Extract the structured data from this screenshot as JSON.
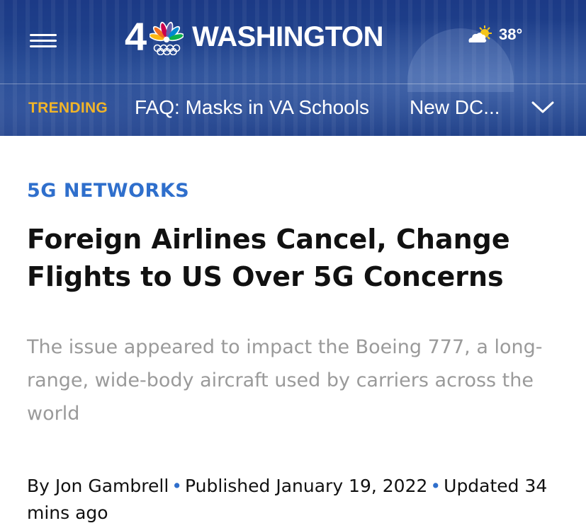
{
  "header": {
    "logo_number": "4",
    "logo_word": "WASHINGTON",
    "weather": {
      "icon": "partly-sunny-icon",
      "temp": "38°"
    }
  },
  "trending": {
    "label": "TRENDING",
    "items": [
      "FAQ: Masks in VA Schools",
      "New DC..."
    ]
  },
  "article": {
    "category": "5G NETWORKS",
    "headline": "Foreign Airlines Cancel, Change Flights to US Over 5G Concerns",
    "dek": "The issue appeared to impact the Boeing 777, a long-range, wide-body aircraft used by carriers across the world",
    "byline": {
      "author": "By Jon Gambrell",
      "published": "Published January 19, 2022",
      "updated": "Updated 34 mins ago"
    }
  },
  "colors": {
    "header_bg": "#21468f",
    "trending_label": "#f0b429",
    "category": "#2f6fcc",
    "dek": "#9a9a9a"
  }
}
